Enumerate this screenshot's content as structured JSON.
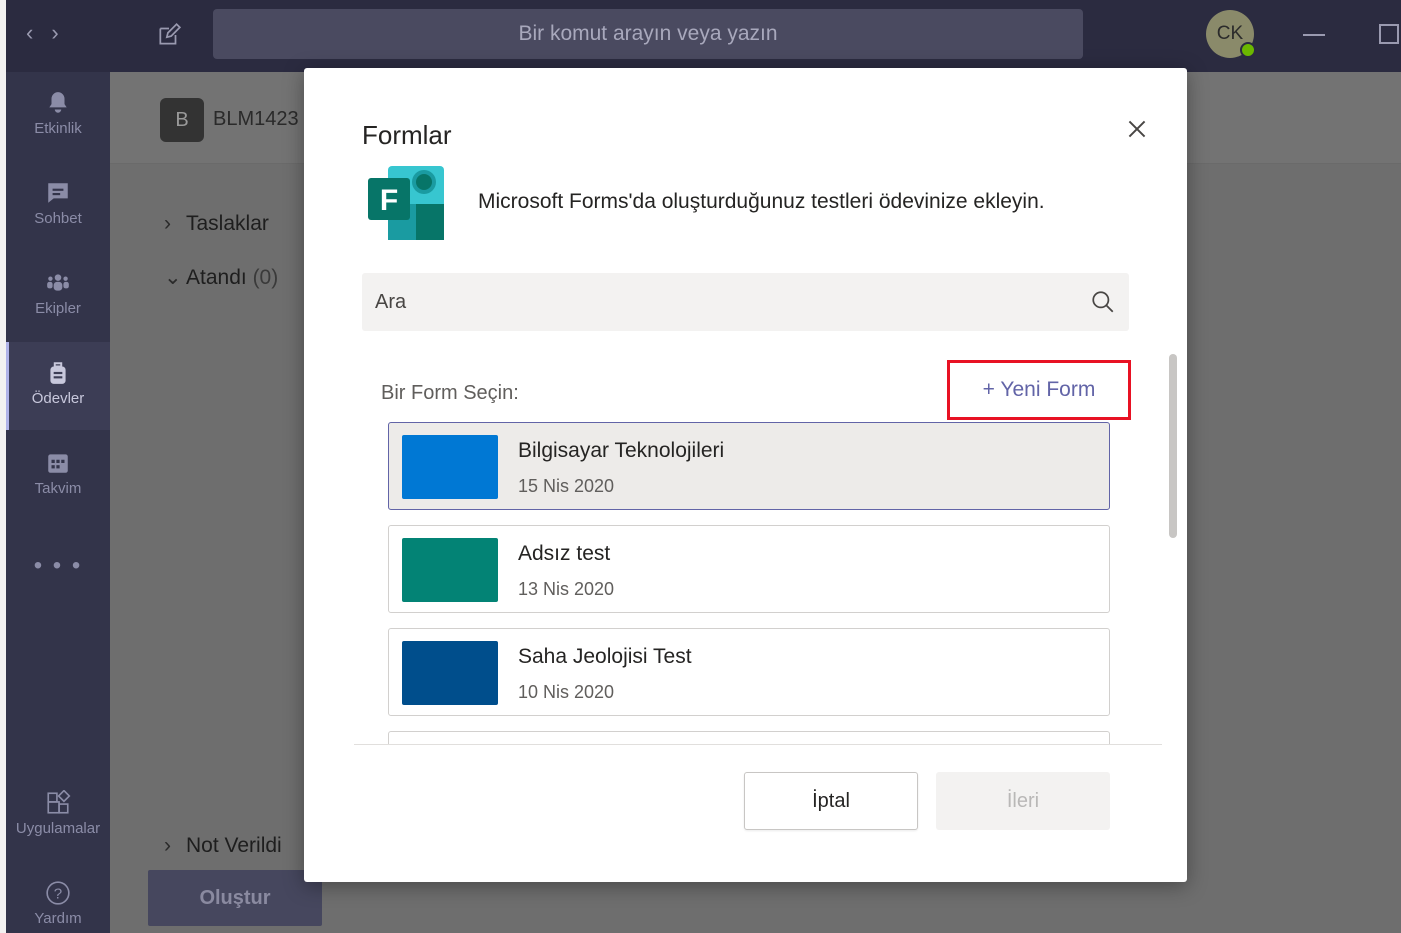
{
  "titlebar": {
    "search_placeholder": "Bir komut arayın veya yazın",
    "avatar_initials": "CK"
  },
  "rail": {
    "items": [
      {
        "label": "Etkinlik",
        "icon": "bell-icon"
      },
      {
        "label": "Sohbet",
        "icon": "chat-icon"
      },
      {
        "label": "Ekipler",
        "icon": "teams-icon"
      },
      {
        "label": "Ödevler",
        "icon": "assignments-icon"
      },
      {
        "label": "Takvim",
        "icon": "calendar-icon"
      }
    ],
    "more": "• • •",
    "apps_label": "Uygulamalar",
    "help_label": "Yardım"
  },
  "page": {
    "team_initial": "B",
    "team_name": "BLM1423",
    "sections": {
      "drafts": "Taslaklar",
      "assigned": "Atandı",
      "assigned_count": "(0)",
      "graded": "Not Verildi"
    },
    "create_label": "Oluştur"
  },
  "dialog": {
    "title": "Formlar",
    "description": "Microsoft Forms'da oluşturduğunuz testleri ödevinize ekleyin.",
    "logo_letter": "F",
    "search_placeholder": "Ara",
    "pick_label": "Bir Form Seçin:",
    "new_form_label": "+ Yeni Form",
    "forms": [
      {
        "title": "Bilgisayar Teknolojileri",
        "date": "15 Nis 2020",
        "color": "#0078d4",
        "selected": true
      },
      {
        "title": "Adsız test",
        "date": "13 Nis 2020",
        "color": "#038375",
        "selected": false
      },
      {
        "title": "Saha Jeolojisi Test",
        "date": "10 Nis 2020",
        "color": "#004e8c",
        "selected": false
      },
      {
        "title": "",
        "date": "",
        "color": "#038375",
        "selected": false
      }
    ],
    "cancel_label": "İptal",
    "next_label": "İleri"
  },
  "colors": {
    "accent": "#6264a7",
    "highlight_box": "#e81123",
    "forms_brand": "#077568"
  }
}
